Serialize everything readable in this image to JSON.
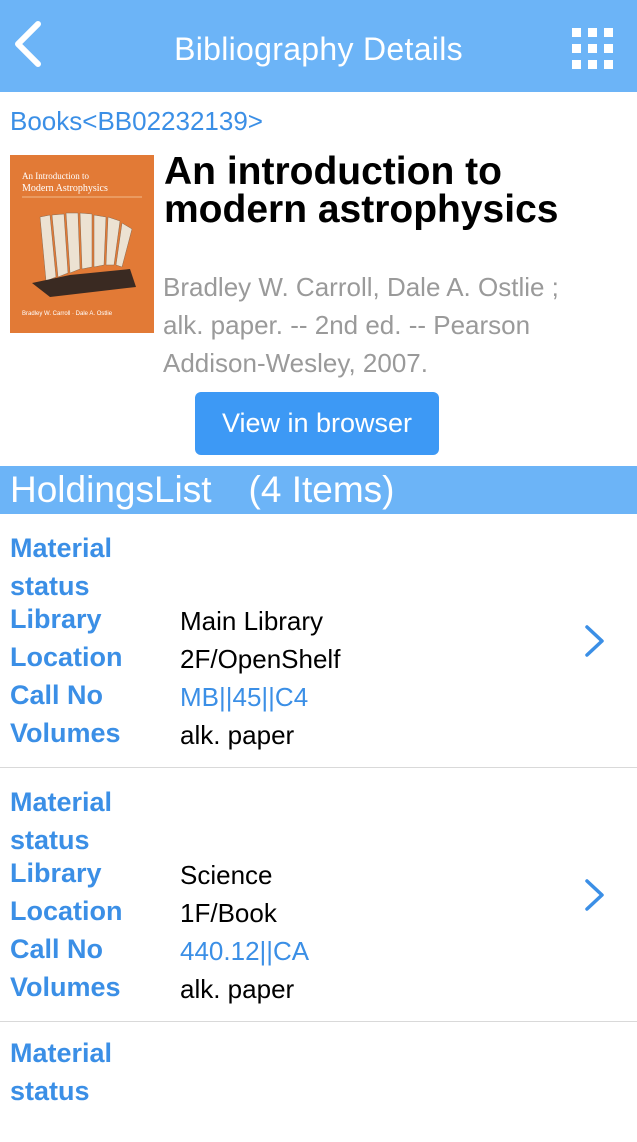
{
  "navbar": {
    "title": "Bibliography Details",
    "back_icon": "chevron-left-icon",
    "menu_icon": "grid-menu-icon"
  },
  "record": {
    "breadcrumb": "Books<BB02232139>",
    "title": "An introduction to modern astrophysics",
    "meta": "Bradley W. Carroll, Dale A. Ostlie ; alk. paper. -- 2nd ed. -- Pearson Addison-Wesley, 2007.",
    "cover": {
      "line1": "An Introduction to",
      "line2": "Modern Astrophysics",
      "authors": "Bradley W. Carroll · Dale A. Ostlie",
      "color": "#e27a36"
    },
    "view_button": "View in browser"
  },
  "holdings": {
    "header": "HoldingsList　(4 Items)",
    "labels": {
      "material_status": "Material status",
      "library": "Library",
      "location": "Location",
      "call_no": "Call No",
      "volumes": "Volumes"
    },
    "items": [
      {
        "material_status": "",
        "library": "Main Library",
        "location": "2F/OpenShelf",
        "call_no": "MB||45||C4",
        "volumes": "alk. paper"
      },
      {
        "material_status": "",
        "library": "Science",
        "location": "1F/Book",
        "call_no": "440.12||CA",
        "volumes": "alk. paper"
      },
      {
        "material_status": ""
      }
    ]
  },
  "colors": {
    "accent": "#6cb4f7",
    "button": "#3d99f5",
    "link": "#3b8fe6"
  }
}
